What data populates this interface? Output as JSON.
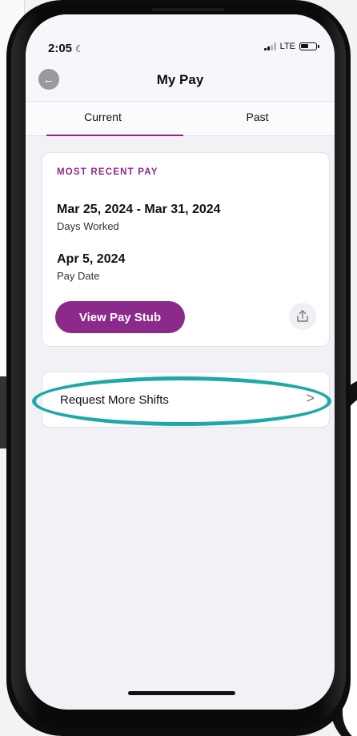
{
  "status_bar": {
    "time": "2:05",
    "network": "LTE"
  },
  "nav": {
    "title": "My Pay",
    "back_icon": "arrow-left-icon"
  },
  "tabs": [
    {
      "label": "Current",
      "active": true
    },
    {
      "label": "Past",
      "active": false
    }
  ],
  "pay_card": {
    "label": "MOST RECENT PAY",
    "range": "Mar 25, 2024 - Mar 31, 2024",
    "range_caption": "Days Worked",
    "pay_date": "Apr 5, 2024",
    "pay_date_caption": "Pay Date",
    "view_button": "View Pay Stub",
    "share_icon": "share-icon"
  },
  "shifts_card": {
    "label": "Request More Shifts",
    "chevron": ">"
  },
  "colors": {
    "accent": "#8b2a8b",
    "highlight": "#1fa8a8"
  }
}
